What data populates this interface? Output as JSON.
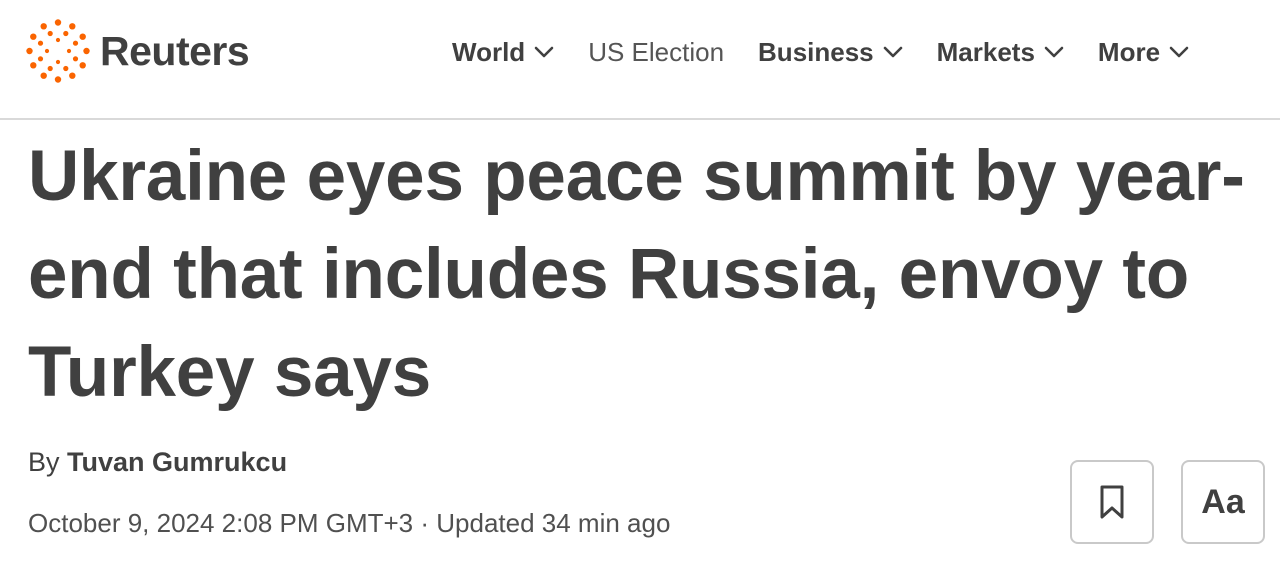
{
  "brand": {
    "name": "Reuters",
    "accent_color": "#fa6400"
  },
  "nav": {
    "items": [
      {
        "label": "World",
        "has_dropdown": true
      },
      {
        "label": "US Election",
        "has_dropdown": false
      },
      {
        "label": "Business",
        "has_dropdown": true
      },
      {
        "label": "Markets",
        "has_dropdown": true
      },
      {
        "label": "More",
        "has_dropdown": true
      }
    ]
  },
  "article": {
    "headline": "Ukraine eyes peace summit by year-end that includes Russia, envoy to Turkey says",
    "byline_prefix": "By",
    "author": "Tuvan Gumrukcu",
    "dateline": "October 9, 2024 2:08 PM GMT+3 · Updated 34 min ago"
  },
  "toolbar": {
    "bookmark_icon": "bookmark-icon",
    "text_size_label": "Aa"
  }
}
